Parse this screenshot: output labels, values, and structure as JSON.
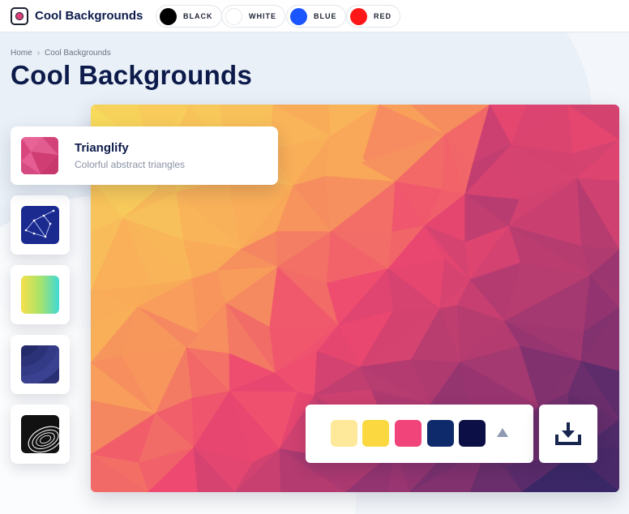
{
  "app": {
    "brand": "Cool Backgrounds"
  },
  "color_filters": [
    {
      "label": "BLACK",
      "color": "#000000"
    },
    {
      "label": "WHITE",
      "color": "#ffffff"
    },
    {
      "label": "BLUE",
      "color": "#1a55ff"
    },
    {
      "label": "RED",
      "color": "#ff1616"
    }
  ],
  "breadcrumb": {
    "home": "Home",
    "separator": "›",
    "current": "Cool Backgrounds"
  },
  "page": {
    "title": "Cool Backgrounds"
  },
  "generators": {
    "active": {
      "name": "Trianglify",
      "description": "Colorful abstract triangles",
      "icon": "triangles-thumbnail"
    },
    "others": [
      {
        "icon": "constellation-thumbnail"
      },
      {
        "icon": "gradient-thumbnail"
      },
      {
        "icon": "waves-thumbnail"
      },
      {
        "icon": "spiral-thumbnail"
      }
    ]
  },
  "palette": {
    "colors": [
      "#fee89a",
      "#fbd840",
      "#f0447a",
      "#0f2a6b",
      "#0b0f45"
    ],
    "toggle_icon": "triangle-up-icon"
  },
  "download": {
    "icon": "download-icon"
  }
}
